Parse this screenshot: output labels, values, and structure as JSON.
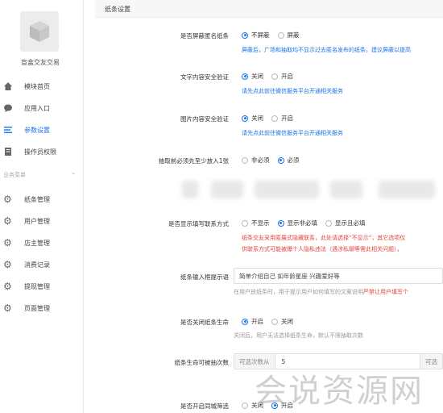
{
  "brand": {
    "name": "盲盒交友交易"
  },
  "sidebar": {
    "items": [
      {
        "label": "模块首页",
        "icon": "home-icon"
      },
      {
        "label": "应用入口",
        "icon": "chat-bubble-icon"
      },
      {
        "label": "参数设置",
        "icon": "menu-lines-icon",
        "active": true
      },
      {
        "label": "操作员权限",
        "icon": "document-icon"
      }
    ],
    "group_label": "业务菜单",
    "group_items": [
      {
        "label": "纸条管理",
        "icon": "gear-icon"
      },
      {
        "label": "用户管理",
        "icon": "gear-icon"
      },
      {
        "label": "店主管理",
        "icon": "gear-icon"
      },
      {
        "label": "消费记录",
        "icon": "gear-icon"
      },
      {
        "label": "提现管理",
        "icon": "gear-icon"
      },
      {
        "label": "页面管理",
        "icon": "gear-icon"
      }
    ]
  },
  "header": {
    "title": "纸条设置"
  },
  "settings": {
    "anon": {
      "label": "是否屏蔽匿名纸条",
      "options": [
        "不屏蔽",
        "屏蔽"
      ],
      "selected": 0,
      "help": "屏蔽后，广场和抽取均不显示过去匿名发布的纸条。建议屏蔽以提高"
    },
    "text_check": {
      "label": "文字内容安全验证",
      "options": [
        "关闭",
        "开启"
      ],
      "selected": 0,
      "help": "请先点此前往微信服务平台开通相关服务"
    },
    "image_check": {
      "label": "图片内容安全验证",
      "options": [
        "关闭",
        "开启"
      ],
      "selected": 0,
      "help": "请先点此前往微信服务平台开通相关服务"
    },
    "must_add": {
      "label": "抽取前必须先至少放入1张",
      "options": [
        "非必须",
        "必须"
      ],
      "selected": 1
    },
    "contact": {
      "label": "是否显示填写联系方式",
      "options": [
        "不显示",
        "显示非必填",
        "显示且必填"
      ],
      "selected": 1,
      "help_line1": "纸条交友采用匿展式隐藏联系，此处请选择“不显示”，其它选项仅",
      "help_line2": "供联系方式可能被爆个人隐私违法（遇涉私聊等需此相关问题），"
    },
    "placeholder": {
      "label": "纸条输入框提示语",
      "value": "简单介绍自己 如年龄星座 兴趣爱好等",
      "help_prefix": "在用户放纸条时，用于提示用户如何填写的文案说明",
      "help_red": "严禁让用户填写个"
    },
    "life": {
      "label": "是否关闭纸条生命",
      "options": [
        "开启",
        "关闭"
      ],
      "selected": 0,
      "help": "关闭后，用户无法选择纸条生命，默认不限抽取次数"
    },
    "life_count": {
      "label": "纸条生命可被抽次数",
      "addon": "可选次数从",
      "value": "5",
      "addon_right": "可选"
    },
    "same_city": {
      "label": "是否开启同城筛选",
      "options": [
        "关闭",
        "开启"
      ],
      "selected": 1
    }
  },
  "watermark": "会说资源网"
}
